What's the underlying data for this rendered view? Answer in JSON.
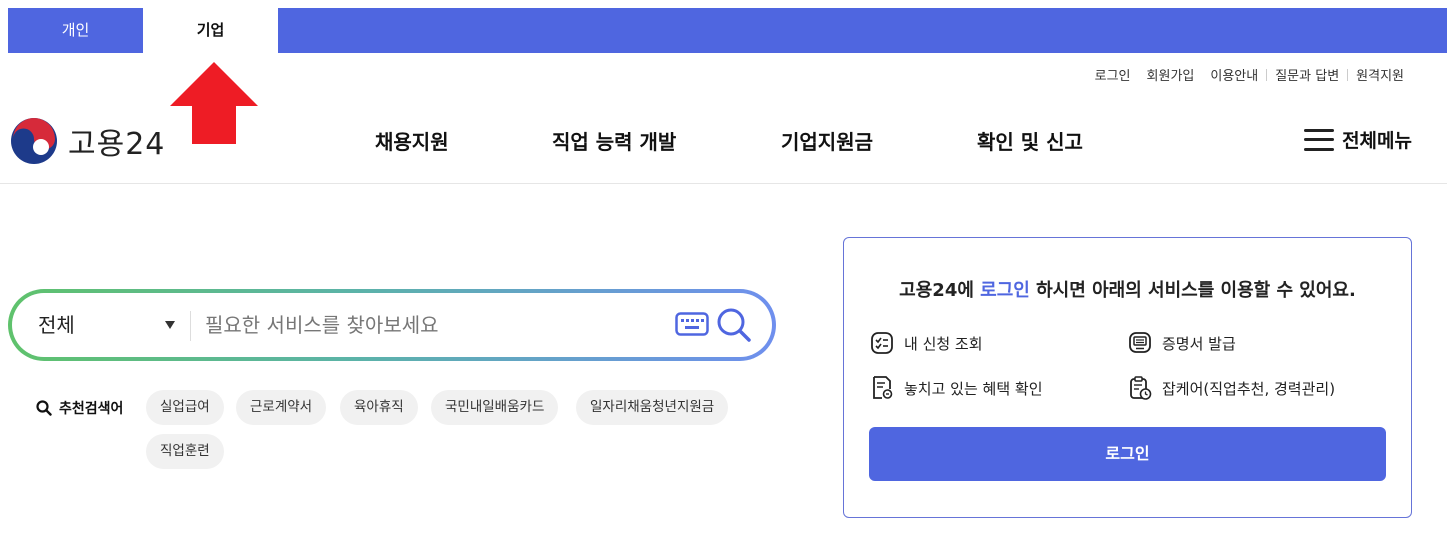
{
  "tabs": {
    "personal": "개인",
    "business": "기업"
  },
  "utility_links": [
    "로그인",
    "회원가입",
    "이용안내",
    "질문과 답변",
    "원격지원"
  ],
  "logo": {
    "text": "고용24"
  },
  "nav": [
    "채용지원",
    "직업 능력 개발",
    "기업지원금",
    "확인 및 신고"
  ],
  "all_menu_label": "전체메뉴",
  "search": {
    "scope": "전체",
    "placeholder": "필요한 서비스를 찾아보세요"
  },
  "recommended": {
    "label": "추천검색어",
    "keywords": [
      "실업급여",
      "근로계약서",
      "육아휴직",
      "국민내일배움카드",
      "일자리채움청년지원금",
      "직업훈련"
    ]
  },
  "login_panel": {
    "title_pre": "고용24에 ",
    "title_link": "로그인",
    "title_post": " 하시면 아래의 서비스를 이용할 수 있어요.",
    "services": [
      "내 신청 조회",
      "증명서 발급",
      "놓치고 있는 혜택 확인",
      "잡케어(직업추천, 경력관리)"
    ],
    "button": "로그인"
  },
  "colors": {
    "brand": "#4f66e0",
    "annotation_arrow": "#ee1c25"
  }
}
